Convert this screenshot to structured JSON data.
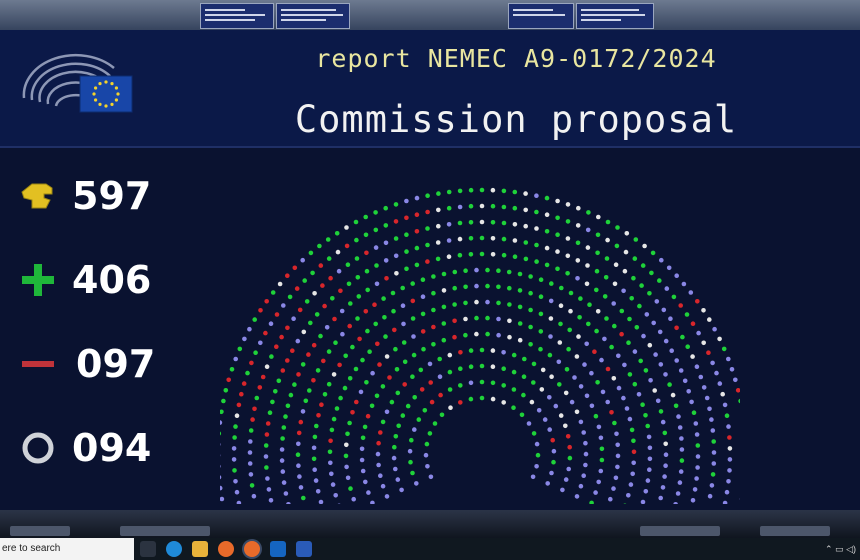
{
  "board": {
    "report_line": "report NEMEC A9-0172/2024",
    "title": "Commission proposal"
  },
  "votes": {
    "total": "597",
    "for": "406",
    "against": "097",
    "abstain": "094"
  },
  "icons": {
    "logo": "european-parliament-logo-icon",
    "total": "voting-hand-icon",
    "for": "plus-icon",
    "against": "minus-icon",
    "abstain": "circle-icon"
  },
  "colors": {
    "for": "#1fd23a",
    "against": "#d8262b",
    "abstain": "#e6e6e6",
    "absent": "#8a87e6",
    "accent_text": "#e9e6a0"
  },
  "taskbar": {
    "search_text": "ere to search"
  }
}
